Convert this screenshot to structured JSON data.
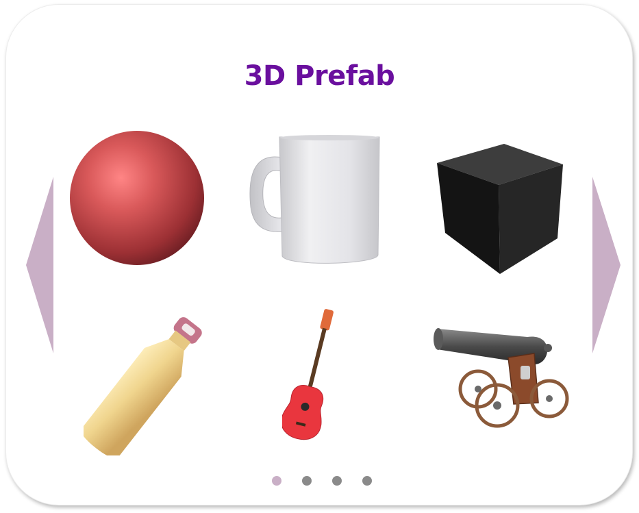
{
  "carousel": {
    "title": "3D Prefab",
    "title_color": "#6a0f9e",
    "arrow_color": "#c9afc6",
    "items": [
      {
        "name": "sphere"
      },
      {
        "name": "mug"
      },
      {
        "name": "cube"
      },
      {
        "name": "bottle"
      },
      {
        "name": "guitar"
      },
      {
        "name": "cannon"
      }
    ],
    "pagination": {
      "page_count": 4,
      "active_index": 0,
      "active_color": "#c9afc6",
      "inactive_color": "#8a8a8a"
    },
    "icons": {
      "prev": "chevron-left-icon",
      "next": "chevron-right-icon"
    }
  }
}
